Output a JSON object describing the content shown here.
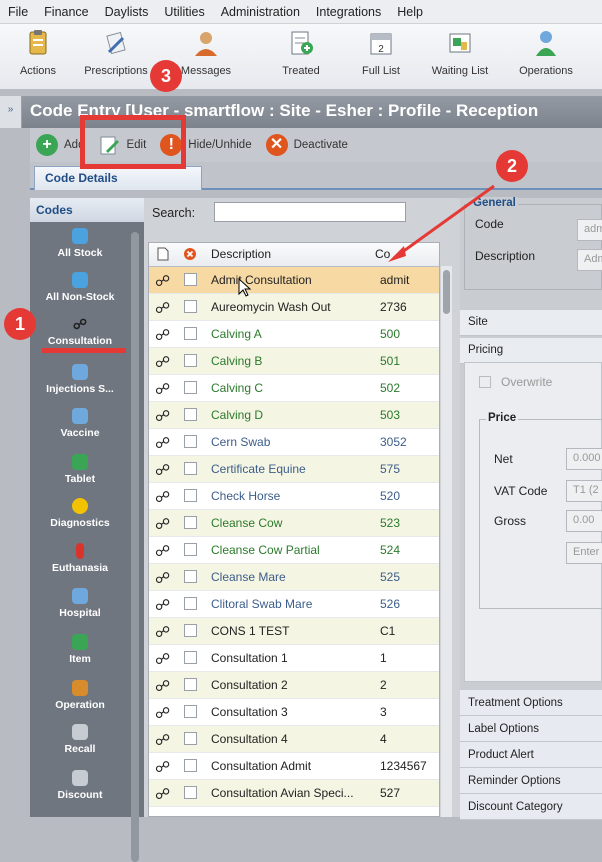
{
  "menubar": {
    "items": [
      "File",
      "Finance",
      "Daylists",
      "Utilities",
      "Administration",
      "Integrations",
      "Help"
    ]
  },
  "toolbar": {
    "buttons": [
      {
        "label": "Actions",
        "icon": "clipboard-icon"
      },
      {
        "label": "Prescriptions",
        "icon": "prescription-icon"
      },
      {
        "label": "Messages",
        "icon": "messages-icon"
      },
      {
        "label": "Treated",
        "icon": "treated-icon"
      },
      {
        "label": "Full List",
        "icon": "calendar-icon"
      },
      {
        "label": "Waiting List",
        "icon": "waiting-list-icon"
      },
      {
        "label": "Operations",
        "icon": "operations-icon"
      }
    ]
  },
  "window": {
    "collapse_label": "»",
    "title": "Code Entry [User - smartflow : Site - Esher : Profile - Reception"
  },
  "actions": {
    "add": "Add",
    "edit": "Edit",
    "hide_unhide": "Hide/Unhide",
    "deactivate": "Deactivate"
  },
  "tabs": {
    "code_details": "Code Details"
  },
  "sidebar": {
    "header": "Codes",
    "items": [
      {
        "label": "All Stock",
        "color": "#4aa3df"
      },
      {
        "label": "All Non-Stock",
        "color": "#4aa3df"
      },
      {
        "label": "Consultation",
        "color": "#222"
      },
      {
        "label": "Injections S...",
        "color": "#6fa8dc"
      },
      {
        "label": "Vaccine",
        "color": "#6fa8dc"
      },
      {
        "label": "Tablet",
        "color": "#3aa655"
      },
      {
        "label": "Diagnostics",
        "color": "#f2c200"
      },
      {
        "label": "Euthanasia",
        "color": "#d9342b"
      },
      {
        "label": "Hospital",
        "color": "#6fa8dc"
      },
      {
        "label": "Item",
        "color": "#3aa655"
      },
      {
        "label": "Operation",
        "color": "#d98c2b"
      },
      {
        "label": "Recall",
        "color": "#9aa0a8"
      },
      {
        "label": "Discount",
        "color": "#9aa0a8"
      }
    ]
  },
  "list": {
    "search_label": "Search:",
    "search_value": "",
    "headers": {
      "description": "Description",
      "code": "Co"
    },
    "rows": [
      {
        "description": "Admit Consultation",
        "code": "admit",
        "style": "sel"
      },
      {
        "description": "Aureomycin Wash Out",
        "code": "2736",
        "style": "y"
      },
      {
        "description": "Calving A",
        "code": "500",
        "style": "green"
      },
      {
        "description": "Calving B",
        "code": "501",
        "style": "green y"
      },
      {
        "description": "Calving C",
        "code": "502",
        "style": "green"
      },
      {
        "description": "Calving D",
        "code": "503",
        "style": "green y"
      },
      {
        "description": "Cern Swab",
        "code": "3052",
        "style": "blue"
      },
      {
        "description": "Certificate Equine",
        "code": "575",
        "style": "blue y"
      },
      {
        "description": "Check Horse",
        "code": "520",
        "style": "blue"
      },
      {
        "description": "Cleanse Cow",
        "code": "523",
        "style": "green y"
      },
      {
        "description": "Cleanse Cow Partial",
        "code": "524",
        "style": "green"
      },
      {
        "description": "Cleanse Mare",
        "code": "525",
        "style": "blue y"
      },
      {
        "description": "Clitoral Swab Mare",
        "code": "526",
        "style": "blue"
      },
      {
        "description": "CONS 1 TEST",
        "code": "C1",
        "style": "y"
      },
      {
        "description": "Consultation 1",
        "code": "1",
        "style": ""
      },
      {
        "description": "Consultation 2",
        "code": "2",
        "style": "y"
      },
      {
        "description": "Consultation 3",
        "code": "3",
        "style": ""
      },
      {
        "description": "Consultation 4",
        "code": "4",
        "style": "y"
      },
      {
        "description": "Consultation Admit",
        "code": "1234567",
        "style": ""
      },
      {
        "description": "Consultation Avian Speci...",
        "code": "527",
        "style": "y"
      }
    ]
  },
  "detail": {
    "general_legend": "General",
    "code_label": "Code",
    "code_value": "adm",
    "description_label": "Description",
    "description_value": "Adm",
    "site_label": "Site",
    "pricing_label": "Pricing",
    "overwrite_label": "Overwrite",
    "price_legend": "Price",
    "net_label": "Net",
    "net_value": "0.000",
    "vat_label": "VAT Code",
    "vat_value": "T1 (2",
    "gross_label": "Gross",
    "gross_value": "0.00",
    "enter_label": "Enter",
    "sections": [
      "Treatment Options",
      "Label Options",
      "Product Alert",
      "Reminder Options",
      "Discount Category"
    ]
  },
  "annotations": {
    "step1": "1",
    "step2": "2",
    "step3": "3"
  },
  "colors": {
    "annotation_red": "#e53935",
    "selected_row": "#f7d9a4",
    "accent_blue": "#1f4d86"
  }
}
